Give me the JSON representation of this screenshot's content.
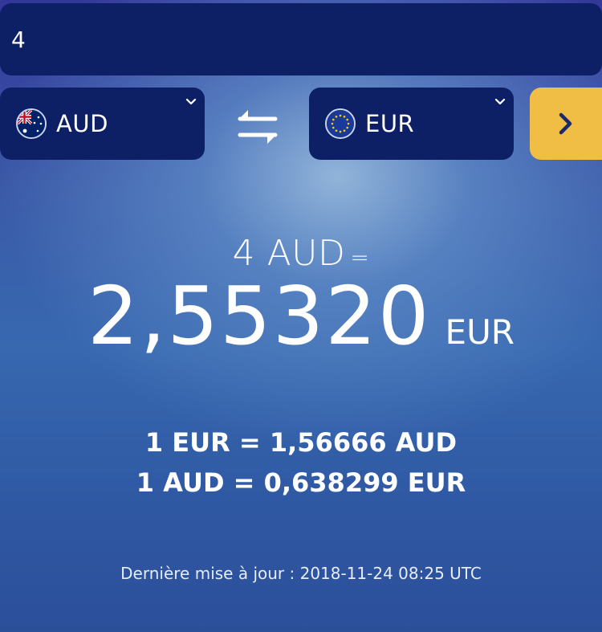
{
  "amount_input": {
    "value": "4"
  },
  "from_currency": {
    "code": "AUD",
    "flag": "australia-flag-icon"
  },
  "to_currency": {
    "code": "EUR",
    "flag": "eu-flag-icon"
  },
  "swap_icon": "swap-arrows-icon",
  "go_icon": "chevron-right-icon",
  "result": {
    "input_label": "4 AUD",
    "equals": "=",
    "value": "2,55320",
    "currency": "EUR"
  },
  "rates": {
    "eur_to_aud": "1 EUR = 1,56666 AUD",
    "aud_to_eur": "1 AUD = 0,638299 EUR"
  },
  "last_update": "Dernière mise à jour : 2018-11-24 08:25 UTC",
  "colors": {
    "input_bg": "#0d2066",
    "accent_button": "#f0be45",
    "button_icon": "#1a2a6e"
  }
}
